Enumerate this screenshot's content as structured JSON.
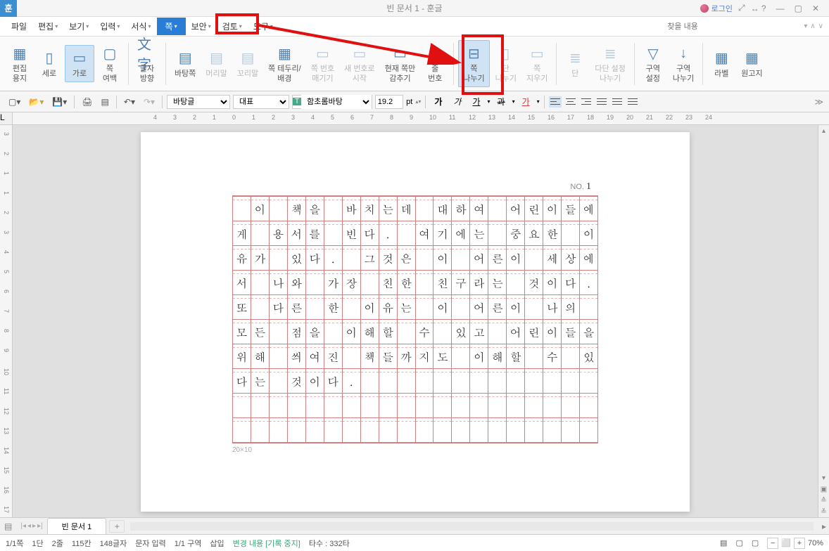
{
  "title": "빈 문서 1 - 훈글",
  "app_icon": "훈",
  "login_label": "로그인",
  "menu": {
    "items": [
      "파일",
      "편집",
      "보기",
      "입력",
      "서식",
      "쪽",
      "보안",
      "검토",
      "도구"
    ],
    "highlighted_index": 5
  },
  "search": {
    "placeholder": "찾을 내용"
  },
  "ribbon": [
    {
      "label": "편집\n용지",
      "icon": "▦"
    },
    {
      "label": "세로",
      "icon": "▯"
    },
    {
      "label": "가로",
      "icon": "▭",
      "selected": true
    },
    {
      "label": "쪽\n여백",
      "icon": "▢"
    },
    {
      "label": "글자\n방향",
      "icon": "文字"
    },
    {
      "label": "바탕쪽",
      "icon": "▤"
    },
    {
      "label": "머리말",
      "icon": "▤",
      "disabled": true
    },
    {
      "label": "꼬리말",
      "icon": "▤",
      "disabled": true
    },
    {
      "label": "쪽 테두리/\n배경",
      "icon": "▦"
    },
    {
      "label": "쪽 번호\n매기기",
      "icon": "▭",
      "disabled": true
    },
    {
      "label": "새 번호로\n시작",
      "icon": "▭",
      "disabled": true
    },
    {
      "label": "현재 쪽만\n감추기",
      "icon": "▭"
    },
    {
      "label": "줄\n번호",
      "icon": "≡"
    },
    {
      "label": "쪽\n나누기",
      "icon": "⊟",
      "target": true
    },
    {
      "label": "단\n나누기",
      "icon": "▯",
      "disabled": true
    },
    {
      "label": "쪽\n지우기",
      "icon": "▭",
      "disabled": true
    },
    {
      "label": "단",
      "icon": "≣",
      "disabled": true
    },
    {
      "label": "다단 설정\n나누기",
      "icon": "≣",
      "disabled": true
    },
    {
      "label": "구역\n설정",
      "icon": "▽"
    },
    {
      "label": "구역\n나누기",
      "icon": "↓"
    },
    {
      "label": "라벨",
      "icon": "▦"
    },
    {
      "label": "원고지",
      "icon": "▦"
    }
  ],
  "toolbar2": {
    "style": "바탕글",
    "rep": "대표",
    "font_prefix": "T",
    "font": "함초롬바탕",
    "size": "19.2",
    "unit": "pt",
    "bold": "가",
    "italic": "가",
    "underline": "가",
    "strike": "과",
    "redunder": "가"
  },
  "ruler_h": [
    "4",
    "3",
    "2",
    "1",
    "0",
    "1",
    "2",
    "3",
    "4",
    "5",
    "6",
    "7",
    "8",
    "9",
    "10",
    "11",
    "12",
    "13",
    "14",
    "15",
    "16",
    "17",
    "18",
    "19",
    "20",
    "21",
    "22",
    "23",
    "24"
  ],
  "ruler_v": [
    "3",
    "2",
    "1",
    "1",
    "2",
    "3",
    "4",
    "5",
    "6",
    "7",
    "8",
    "9",
    "10",
    "11",
    "12",
    "13",
    "14",
    "15",
    "16",
    "17"
  ],
  "page_no_label": "NO.",
  "page_no": "1",
  "grid_rows": [
    [
      "",
      " 이",
      " ",
      "책",
      "을",
      " ",
      "바",
      "치",
      "는",
      "데",
      " ",
      "대",
      "하",
      "여",
      " ",
      "어",
      "린",
      "이",
      "들",
      "에"
    ],
    [
      "게",
      " ",
      "용",
      "서",
      "를",
      " ",
      "빈",
      "다",
      ".",
      " ",
      "여",
      "기",
      "에",
      "는",
      " ",
      "중",
      "요",
      "한",
      " ",
      "이"
    ],
    [
      "유",
      "가",
      " ",
      "있",
      "다",
      ".",
      " ",
      "그",
      "것",
      "은",
      " ",
      "이",
      " ",
      "어",
      "른",
      "이",
      " ",
      "세",
      "상",
      "에"
    ],
    [
      "서",
      " ",
      "나",
      "와",
      " ",
      "가",
      "장",
      " ",
      "친",
      "한",
      " ",
      "친",
      "구",
      "라",
      "는",
      " ",
      "것",
      "이",
      "다",
      "."
    ],
    [
      "또",
      " ",
      "다",
      "른",
      " ",
      "한",
      " ",
      "이",
      "유",
      "는",
      " ",
      "이",
      " ",
      "어",
      "른",
      "이",
      " ",
      "나",
      "의",
      " "
    ],
    [
      "모",
      "든",
      " ",
      "점",
      "을",
      " ",
      "이",
      "해",
      "할",
      " ",
      "수",
      " ",
      "있",
      "고",
      " ",
      "어",
      "린",
      "이",
      "들",
      "을"
    ],
    [
      "위",
      "해",
      " ",
      "씌",
      "여",
      "진",
      " ",
      "책",
      "들",
      "까",
      "지",
      "도",
      " ",
      "이",
      "해",
      "할",
      " ",
      "수",
      " ",
      "있"
    ],
    [
      "다",
      "는",
      " ",
      "것",
      "이",
      "다",
      ".",
      "",
      "",
      "",
      "",
      "",
      "",
      "",
      "",
      "",
      "",
      "",
      "",
      ""
    ],
    [
      "",
      "",
      "",
      "",
      "",
      "",
      "",
      "",
      "",
      "",
      "",
      "",
      "",
      "",
      "",
      "",
      "",
      "",
      "",
      ""
    ],
    [
      "",
      "",
      "",
      "",
      "",
      "",
      "",
      "",
      "",
      "",
      "",
      "",
      "",
      "",
      "",
      "",
      "",
      "",
      "",
      ""
    ]
  ],
  "grid_size": "20×10",
  "doc_tab": "빈 문서 1",
  "status": {
    "page": "1/1쪽",
    "dan": "1단",
    "line": "2줄",
    "col": "115칸",
    "chars": "148글자",
    "mode": "문자 입력",
    "section": "1/1 구역",
    "insert": "삽입",
    "change": "변경 내용 [기록 중지]",
    "count": "타수 : 332타",
    "zoom": "70%"
  }
}
